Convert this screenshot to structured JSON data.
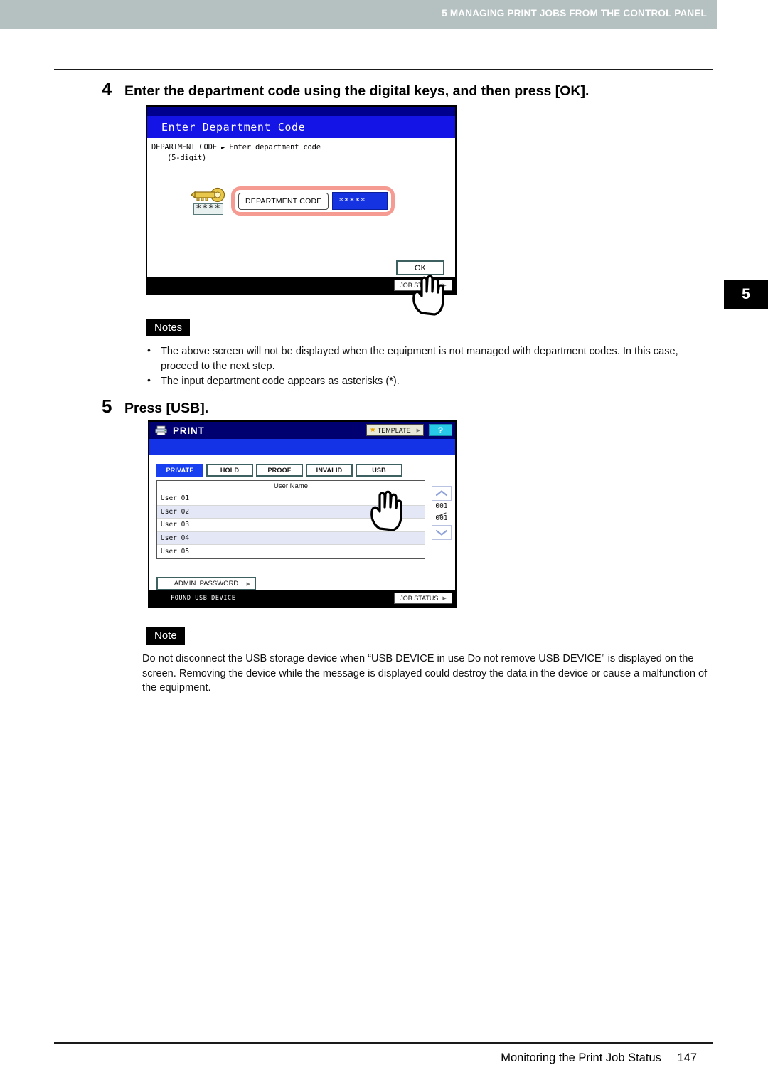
{
  "header": {
    "running_head": "5 MANAGING PRINT JOBS FROM THE CONTROL PANEL",
    "chapter_tab": "5"
  },
  "footer": {
    "title": "Monitoring the Print Job Status",
    "page_number": "147"
  },
  "steps": [
    {
      "number": "4",
      "title": "Enter the department code using the digital keys, and then press [OK]."
    },
    {
      "number": "5",
      "title": "Press [USB]."
    }
  ],
  "dept_panel": {
    "title": "Enter Department Code",
    "message_line1_label": "DEPARTMENT CODE",
    "message_line1_arrow": "►",
    "message_line1_text": "Enter department code",
    "message_line2": "(5-digit)",
    "key_asterisks": "****",
    "field_label": "DEPARTMENT CODE",
    "field_value": "*****",
    "ok_label": "OK",
    "job_status_label": "JOB STATUS"
  },
  "notes_block": {
    "tag": "Notes",
    "items": [
      "The above screen will not be displayed when the equipment is not managed with department codes. In this case, proceed to the next step.",
      "The input department code appears as asterisks (*)."
    ]
  },
  "print_panel": {
    "title": "PRINT",
    "template_label": "TEMPLATE",
    "help_label": "?",
    "tabs": [
      {
        "label": "PRIVATE",
        "selected": true
      },
      {
        "label": "HOLD",
        "selected": false
      },
      {
        "label": "PROOF",
        "selected": false
      },
      {
        "label": "INVALID",
        "selected": false
      },
      {
        "label": "USB",
        "selected": false
      }
    ],
    "table_header": "User Name",
    "rows": [
      "User 01",
      "User 02",
      "User 03",
      "User 04",
      "User 05"
    ],
    "page_current": "001",
    "page_total": "001",
    "admin_password_label": "ADMIN. PASSWORD",
    "status_message": "FOUND USB DEVICE",
    "job_status_label": "JOB STATUS"
  },
  "note_block": {
    "tag": "Note",
    "text": "Do not disconnect the USB storage device when “USB DEVICE in use Do not remove USB DEVICE” is displayed on the screen. Removing the device while the message is displayed could destroy the data in the device or cause a malfunction of the equipment."
  },
  "colors": {
    "header_band": "#b5c0c0",
    "panel_title_blue": "#1414e6",
    "panel_title_dark": "#00008f",
    "print_title_navy": "#000070",
    "selected_tab": "#1840f0",
    "highlight_red": "#f59b92",
    "help_cyan": "#28c8e8"
  }
}
